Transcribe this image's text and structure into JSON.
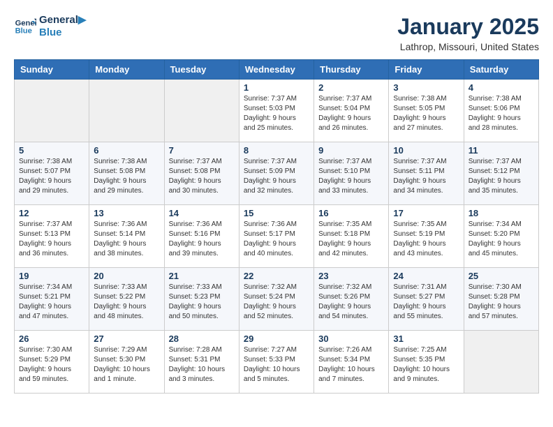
{
  "logo": {
    "line1": "General",
    "line2": "Blue"
  },
  "title": "January 2025",
  "subtitle": "Lathrop, Missouri, United States",
  "weekdays": [
    "Sunday",
    "Monday",
    "Tuesday",
    "Wednesday",
    "Thursday",
    "Friday",
    "Saturday"
  ],
  "weeks": [
    [
      {
        "day": "",
        "info": ""
      },
      {
        "day": "",
        "info": ""
      },
      {
        "day": "",
        "info": ""
      },
      {
        "day": "1",
        "info": "Sunrise: 7:37 AM\nSunset: 5:03 PM\nDaylight: 9 hours\nand 25 minutes."
      },
      {
        "day": "2",
        "info": "Sunrise: 7:37 AM\nSunset: 5:04 PM\nDaylight: 9 hours\nand 26 minutes."
      },
      {
        "day": "3",
        "info": "Sunrise: 7:38 AM\nSunset: 5:05 PM\nDaylight: 9 hours\nand 27 minutes."
      },
      {
        "day": "4",
        "info": "Sunrise: 7:38 AM\nSunset: 5:06 PM\nDaylight: 9 hours\nand 28 minutes."
      }
    ],
    [
      {
        "day": "5",
        "info": "Sunrise: 7:38 AM\nSunset: 5:07 PM\nDaylight: 9 hours\nand 29 minutes."
      },
      {
        "day": "6",
        "info": "Sunrise: 7:38 AM\nSunset: 5:08 PM\nDaylight: 9 hours\nand 29 minutes."
      },
      {
        "day": "7",
        "info": "Sunrise: 7:37 AM\nSunset: 5:08 PM\nDaylight: 9 hours\nand 30 minutes."
      },
      {
        "day": "8",
        "info": "Sunrise: 7:37 AM\nSunset: 5:09 PM\nDaylight: 9 hours\nand 32 minutes."
      },
      {
        "day": "9",
        "info": "Sunrise: 7:37 AM\nSunset: 5:10 PM\nDaylight: 9 hours\nand 33 minutes."
      },
      {
        "day": "10",
        "info": "Sunrise: 7:37 AM\nSunset: 5:11 PM\nDaylight: 9 hours\nand 34 minutes."
      },
      {
        "day": "11",
        "info": "Sunrise: 7:37 AM\nSunset: 5:12 PM\nDaylight: 9 hours\nand 35 minutes."
      }
    ],
    [
      {
        "day": "12",
        "info": "Sunrise: 7:37 AM\nSunset: 5:13 PM\nDaylight: 9 hours\nand 36 minutes."
      },
      {
        "day": "13",
        "info": "Sunrise: 7:36 AM\nSunset: 5:14 PM\nDaylight: 9 hours\nand 38 minutes."
      },
      {
        "day": "14",
        "info": "Sunrise: 7:36 AM\nSunset: 5:16 PM\nDaylight: 9 hours\nand 39 minutes."
      },
      {
        "day": "15",
        "info": "Sunrise: 7:36 AM\nSunset: 5:17 PM\nDaylight: 9 hours\nand 40 minutes."
      },
      {
        "day": "16",
        "info": "Sunrise: 7:35 AM\nSunset: 5:18 PM\nDaylight: 9 hours\nand 42 minutes."
      },
      {
        "day": "17",
        "info": "Sunrise: 7:35 AM\nSunset: 5:19 PM\nDaylight: 9 hours\nand 43 minutes."
      },
      {
        "day": "18",
        "info": "Sunrise: 7:34 AM\nSunset: 5:20 PM\nDaylight: 9 hours\nand 45 minutes."
      }
    ],
    [
      {
        "day": "19",
        "info": "Sunrise: 7:34 AM\nSunset: 5:21 PM\nDaylight: 9 hours\nand 47 minutes."
      },
      {
        "day": "20",
        "info": "Sunrise: 7:33 AM\nSunset: 5:22 PM\nDaylight: 9 hours\nand 48 minutes."
      },
      {
        "day": "21",
        "info": "Sunrise: 7:33 AM\nSunset: 5:23 PM\nDaylight: 9 hours\nand 50 minutes."
      },
      {
        "day": "22",
        "info": "Sunrise: 7:32 AM\nSunset: 5:24 PM\nDaylight: 9 hours\nand 52 minutes."
      },
      {
        "day": "23",
        "info": "Sunrise: 7:32 AM\nSunset: 5:26 PM\nDaylight: 9 hours\nand 54 minutes."
      },
      {
        "day": "24",
        "info": "Sunrise: 7:31 AM\nSunset: 5:27 PM\nDaylight: 9 hours\nand 55 minutes."
      },
      {
        "day": "25",
        "info": "Sunrise: 7:30 AM\nSunset: 5:28 PM\nDaylight: 9 hours\nand 57 minutes."
      }
    ],
    [
      {
        "day": "26",
        "info": "Sunrise: 7:30 AM\nSunset: 5:29 PM\nDaylight: 9 hours\nand 59 minutes."
      },
      {
        "day": "27",
        "info": "Sunrise: 7:29 AM\nSunset: 5:30 PM\nDaylight: 10 hours\nand 1 minute."
      },
      {
        "day": "28",
        "info": "Sunrise: 7:28 AM\nSunset: 5:31 PM\nDaylight: 10 hours\nand 3 minutes."
      },
      {
        "day": "29",
        "info": "Sunrise: 7:27 AM\nSunset: 5:33 PM\nDaylight: 10 hours\nand 5 minutes."
      },
      {
        "day": "30",
        "info": "Sunrise: 7:26 AM\nSunset: 5:34 PM\nDaylight: 10 hours\nand 7 minutes."
      },
      {
        "day": "31",
        "info": "Sunrise: 7:25 AM\nSunset: 5:35 PM\nDaylight: 10 hours\nand 9 minutes."
      },
      {
        "day": "",
        "info": ""
      }
    ]
  ]
}
